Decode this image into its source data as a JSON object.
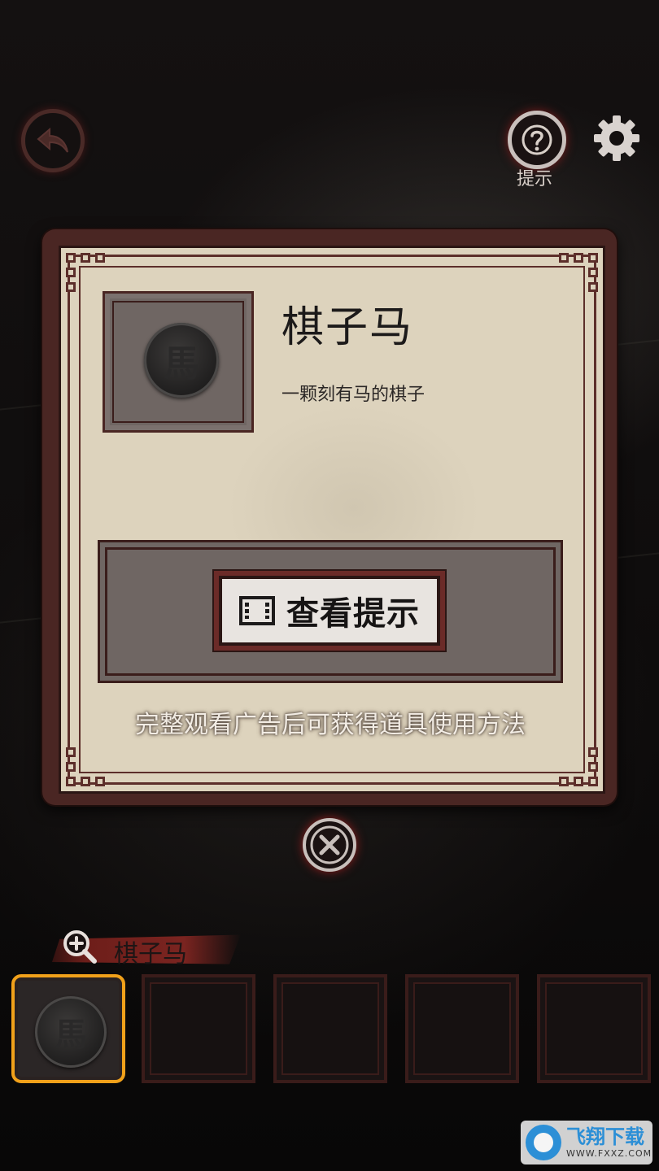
{
  "header": {
    "hint_label": "提示",
    "icons": {
      "back": "back-arrow-icon",
      "hint": "question-mark-icon",
      "settings": "gear-icon"
    }
  },
  "item_panel": {
    "title": "棋子马",
    "description": "一颗刻有马的棋子",
    "piece_glyph": "馬",
    "view_hint_button_label": "查看提示",
    "view_hint_icon": "film-icon",
    "ad_note": "完整观看广告后可获得道具使用方法",
    "close_icon": "close-icon"
  },
  "inventory": {
    "selected_name": "棋子马",
    "zoom_icon": "zoom-in-icon",
    "slots": [
      {
        "piece_glyph": "馬",
        "selected": true
      },
      {
        "piece_glyph": "",
        "selected": false
      },
      {
        "piece_glyph": "",
        "selected": false
      },
      {
        "piece_glyph": "",
        "selected": false
      },
      {
        "piece_glyph": "",
        "selected": false
      }
    ],
    "selected_color": "#f1a11a"
  },
  "watermark": {
    "title": "飞翔下载",
    "url": "WWW.FXXZ.COM"
  }
}
